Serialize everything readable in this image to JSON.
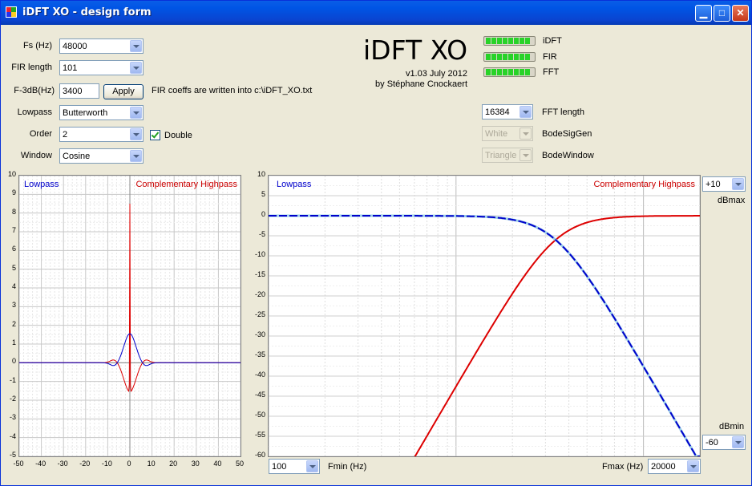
{
  "window": {
    "title": "iDFT XO - design form"
  },
  "controls": {
    "fs": {
      "label": "Fs (Hz)",
      "value": "48000"
    },
    "fir_length": {
      "label": "FIR length",
      "value": "101"
    },
    "f3db": {
      "label": "F-3dB(Hz)",
      "value": "3400"
    },
    "apply_label": "Apply",
    "coeffs_note": "FIR coeffs are written into c:\\iDFT_XO.txt",
    "lowpass": {
      "label": "Lowpass",
      "value": "Butterworth"
    },
    "order": {
      "label": "Order",
      "value": "2"
    },
    "double_label": "Double",
    "window": {
      "label": "Window",
      "value": "Cosine"
    }
  },
  "branding": {
    "title": "iDFT XO",
    "version": "v1.03 July 2012",
    "author": "by Stéphane Cnockaert"
  },
  "indicators": [
    {
      "label": "iDFT",
      "segments": 10
    },
    {
      "label": "FIR",
      "segments": 10
    },
    {
      "label": "FFT",
      "segments": 10
    }
  ],
  "fft": {
    "fft_length": {
      "value": "16384",
      "label": "FFT length"
    },
    "bode_sig_gen": {
      "value": "White",
      "label": "BodeSigGen"
    },
    "bode_window": {
      "value": "Triangle",
      "label": "BodeWindow"
    }
  },
  "impulse_plot": {
    "legend_lowpass": "Lowpass",
    "legend_highpass": "Complementary Highpass",
    "x_ticks": [
      "-50",
      "-40",
      "-30",
      "-20",
      "-10",
      "0",
      "10",
      "20",
      "30",
      "40",
      "50"
    ],
    "y_ticks": [
      "10",
      "9",
      "8",
      "7",
      "6",
      "5",
      "4",
      "3",
      "2",
      "1",
      "0",
      "-1",
      "-2",
      "-3",
      "-4",
      "-5"
    ]
  },
  "bode_plot": {
    "legend_lowpass": "Lowpass",
    "legend_highpass": "Complementary Highpass",
    "y_ticks": [
      "10",
      "5",
      "0",
      "-5",
      "-10",
      "-15",
      "-20",
      "-25",
      "-30",
      "-35",
      "-40",
      "-45",
      "-50",
      "-55",
      "-60"
    ],
    "dbmax": {
      "value": "+10",
      "label": "dBmax"
    },
    "dbmin": {
      "value": "-60",
      "label": "dBmin"
    },
    "fmin": {
      "value": "100",
      "label": "Fmin (Hz)"
    },
    "fmax": {
      "value": "20000",
      "label": "Fmax (Hz)"
    }
  },
  "colors": {
    "lowpass": "#0000cc",
    "highpass": "#dd0000",
    "led": "#28d328"
  }
}
